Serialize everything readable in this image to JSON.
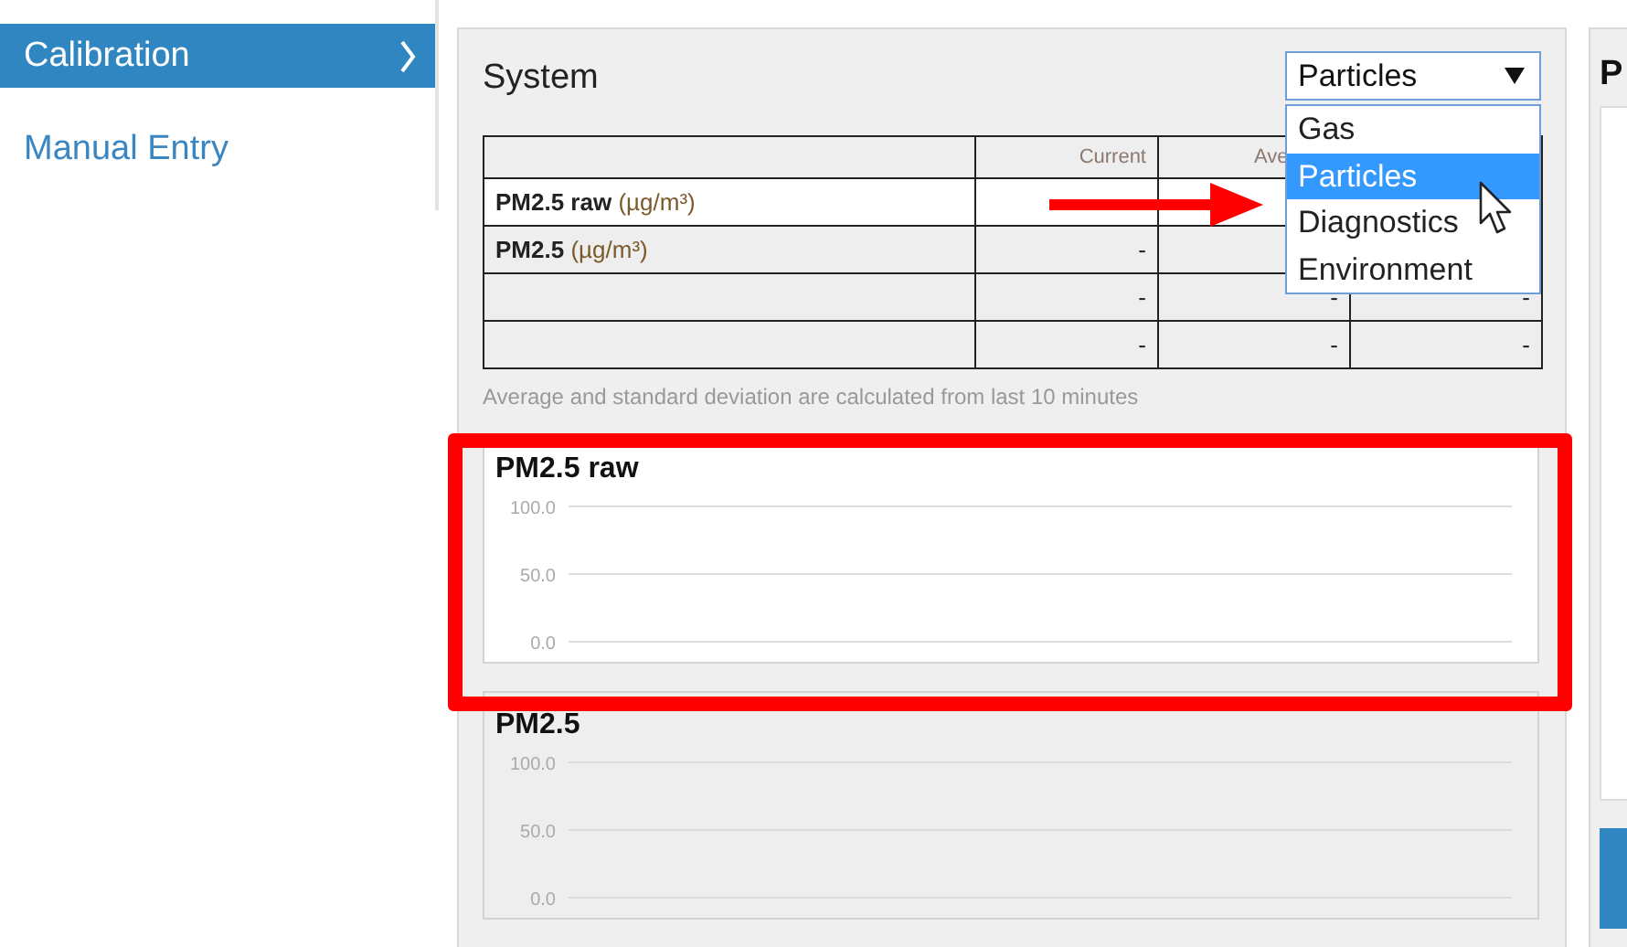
{
  "sidebar": {
    "items": [
      {
        "label": "Calibration",
        "selected": true
      },
      {
        "label": "Manual Entry",
        "selected": false
      }
    ]
  },
  "panel": {
    "title": "System",
    "dropdown": {
      "value": "Particles",
      "expanded": true,
      "options": [
        {
          "label": "Gas",
          "selected": false
        },
        {
          "label": "Particles",
          "selected": true
        },
        {
          "label": "Diagnostics",
          "selected": false
        },
        {
          "label": "Environment",
          "selected": false
        }
      ]
    },
    "table": {
      "columns": [
        "Current",
        "Ave"
      ],
      "rows": [
        {
          "label": "PM2.5 raw",
          "unit": "(µg/m³)",
          "selected": true
        },
        {
          "label": "PM2.5",
          "unit": "(µg/m³)",
          "selected": false,
          "cells": [
            "-"
          ]
        },
        {
          "selected": false,
          "cells": [
            "-",
            "-",
            "-"
          ]
        },
        {
          "selected": false,
          "cells": [
            "-",
            "-",
            "-"
          ]
        }
      ]
    },
    "note": "Average and standard deviation are calculated from last 10 minutes",
    "charts": [
      {
        "highlighted": true,
        "title": "PM2.5 raw",
        "axis_labels": [
          "100.0",
          "50.0",
          "0.0"
        ]
      },
      {
        "highlighted": false,
        "title": "PM2.5",
        "axis_labels": [
          "100.0",
          "50.0",
          "0.0"
        ]
      }
    ]
  },
  "right_panel": {
    "title": "P"
  },
  "annotations": {
    "arrow": true,
    "frame": true
  }
}
